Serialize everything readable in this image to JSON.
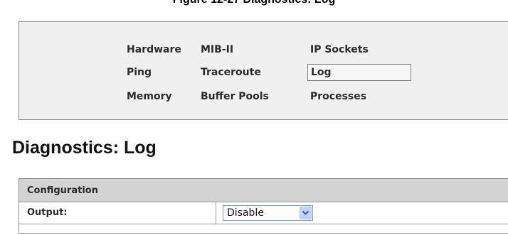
{
  "caption": "Figure 12-27 Diagnostics: Log",
  "nav": {
    "items": [
      {
        "label": "Hardware"
      },
      {
        "label": "MIB-II"
      },
      {
        "label": "IP Sockets"
      },
      {
        "label": "Ping"
      },
      {
        "label": "Traceroute"
      },
      {
        "label": "Log"
      },
      {
        "label": "Memory"
      },
      {
        "label": "Buffer Pools"
      },
      {
        "label": "Processes"
      }
    ],
    "active": "Log"
  },
  "page_title": "Diagnostics: Log",
  "config": {
    "header": "Configuration",
    "rows": [
      {
        "label": "Output:",
        "value": "Disable"
      }
    ]
  },
  "icons": {
    "dropdown": "chevron-down-icon"
  },
  "colors": {
    "panel_bg": "#f0f0f0",
    "header_bg": "#d3d3d3",
    "select_button": "#c3d3fd"
  }
}
